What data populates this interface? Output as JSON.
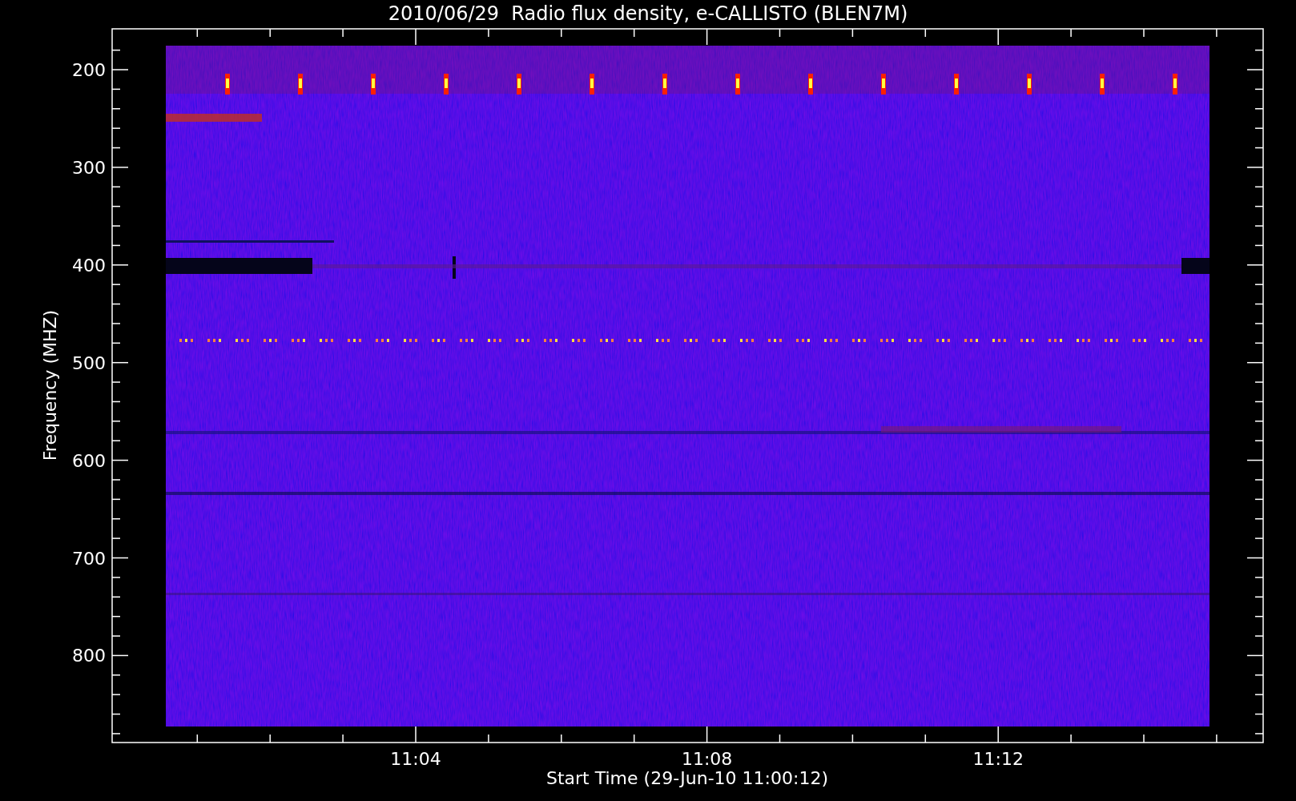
{
  "title": "2010/06/29  Radio flux density, e-CALLISTO (BLEN7M)",
  "y_axis": {
    "label": "Frequency (MHZ)",
    "ticks": [
      "200",
      "300",
      "400",
      "500",
      "600",
      "700",
      "800"
    ]
  },
  "x_axis": {
    "label": "Start Time (29-Jun-10 11:00:12)",
    "ticks": [
      "11:04",
      "11:08",
      "11:12"
    ]
  }
}
